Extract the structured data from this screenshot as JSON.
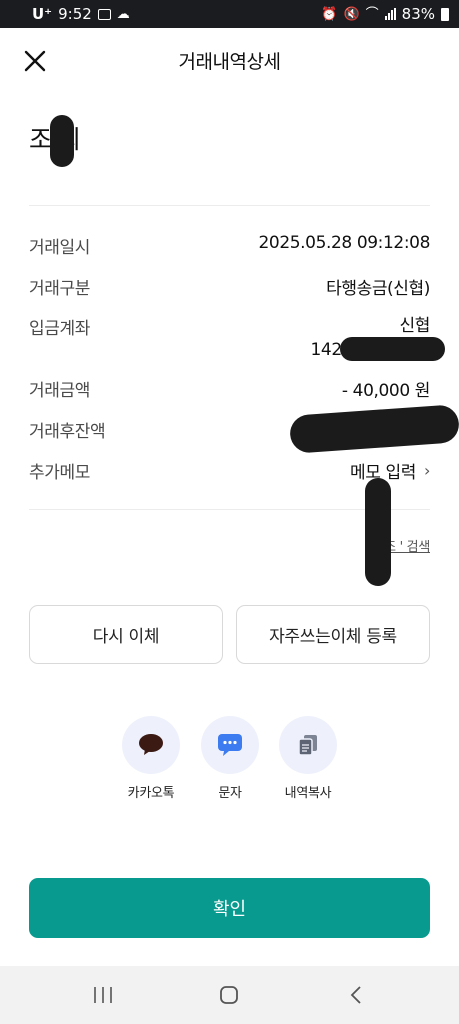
{
  "status_bar": {
    "carrier": "U⁺",
    "time": "9:52",
    "battery": "83%"
  },
  "header": {
    "title": "거래내역상세"
  },
  "recipient": {
    "name": "조 희"
  },
  "details": {
    "datetime_label": "거래일시",
    "datetime_value": "2025.05.28 09:12:08",
    "type_label": "거래구분",
    "type_value": "타행송금(신협)",
    "account_label": "입금계좌",
    "account_bank": "신협",
    "account_number": "142",
    "amount_label": "거래금액",
    "amount_value": "- 40,000 원",
    "balance_label": "거래후잔액",
    "memo_label": "추가메모",
    "memo_value": "메모 입력"
  },
  "search_link": "'조 ' 검색",
  "buttons": {
    "retransfer": "다시 이체",
    "favorite": "자주쓰는이체 등록"
  },
  "share": {
    "kakao": "카카오톡",
    "sms": "문자",
    "copy": "내역복사"
  },
  "confirm_label": "확인"
}
